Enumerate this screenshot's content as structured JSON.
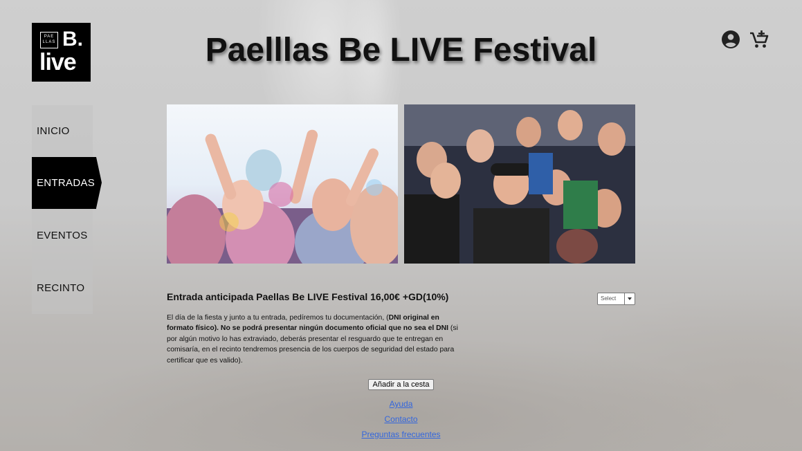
{
  "brand": {
    "logo_top": "PAE LLAS",
    "logo_b": "B.",
    "logo_live": "live"
  },
  "header": {
    "title": "Paelllas Be LIVE Festival",
    "icons": [
      "account-icon",
      "add-to-cart-icon"
    ]
  },
  "nav": {
    "items": [
      {
        "label": "INICIO",
        "active": false
      },
      {
        "label": "ENTRADAS",
        "active": true
      },
      {
        "label": "EVENTOS",
        "active": false
      },
      {
        "label": "RECINTO",
        "active": false
      }
    ]
  },
  "product": {
    "title": "Entrada anticipada Paellas Be LIVE Festival 16,00€ +GD(10%)",
    "quantity_select": {
      "value": "Select"
    },
    "description": {
      "p1": "El día de la fiesta y junto a tu entrada, pedíremos tu documentación, (",
      "b1": "DNI original en formato físico). No se podrá presentar ningún documento oficial que no sea el DNI",
      "p2": " (si por algún motivo lo has extraviado, deberás presentar el resguardo que te entregan en comisaría, en el recinto tendremos presencia de los cuerpos de seguridad del estado para certificar que es valido)."
    },
    "add_to_cart_label": "Añadir a la cesta"
  },
  "footer": {
    "links": [
      "Ayuda",
      "Contacto",
      "Preguntas frecuentes"
    ]
  }
}
